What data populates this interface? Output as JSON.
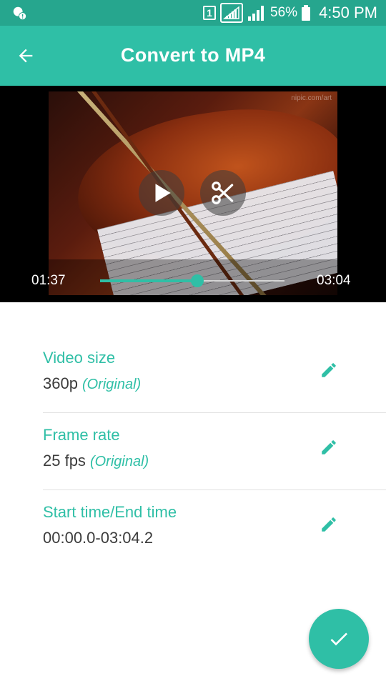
{
  "status_bar": {
    "sim_label": "1",
    "battery": "56%",
    "time": "4:50 PM"
  },
  "app_bar": {
    "title": "Convert to MP4",
    "back_icon": "arrow-left-icon"
  },
  "player": {
    "current_time": "01:37",
    "total_time": "03:04",
    "progress": 0.527,
    "watermark": "nipic.com/art",
    "play_icon": "play-icon",
    "cut_icon": "scissors-icon"
  },
  "settings": [
    {
      "label": "Video size",
      "value": "360p",
      "note": "(Original)"
    },
    {
      "label": "Frame rate",
      "value": "25 fps",
      "note": "(Original)"
    },
    {
      "label": "Start time/End time",
      "value": "00:00.0-03:04.2",
      "note": ""
    }
  ],
  "colors": {
    "accent": "#2fbfa6",
    "status_bar": "#26a68e",
    "text": "#3c3c3c"
  },
  "fab_icon": "check-icon"
}
